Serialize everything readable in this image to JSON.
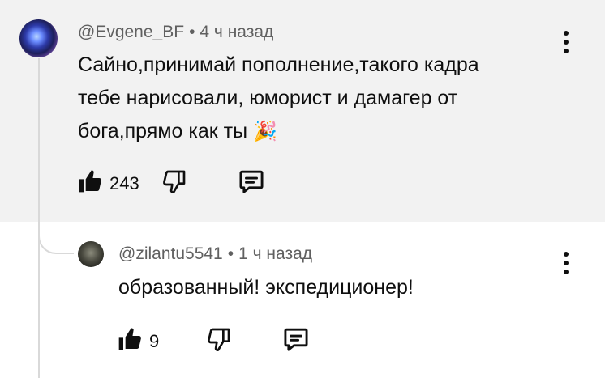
{
  "comment": {
    "author": "@Evgene_BF",
    "separator": "•",
    "time": "4 ч назад",
    "text_lines": [
      "Сайно,принимай пополнение,такого кадра",
      "тебе нарисовали, юморист и дамагер от",
      "бога,прямо как ты"
    ],
    "emoji": "🎉",
    "likes": "243",
    "icons": {
      "like": "thumbs-up-icon",
      "dislike": "thumbs-down-icon",
      "reply": "reply-icon",
      "menu": "more-vert-icon"
    }
  },
  "reply": {
    "author": "@zilantu5541",
    "separator": "•",
    "time": "1 ч назад",
    "text": "образованный! экспедиционер!",
    "likes": "9",
    "icons": {
      "like": "thumbs-up-icon",
      "dislike": "thumbs-down-icon",
      "reply": "reply-icon",
      "menu": "more-vert-icon"
    }
  },
  "colors": {
    "highlight_bg": "#f2f2f2",
    "text": "#0f0f0f",
    "meta": "#606060",
    "thread": "#d9d9d9"
  }
}
